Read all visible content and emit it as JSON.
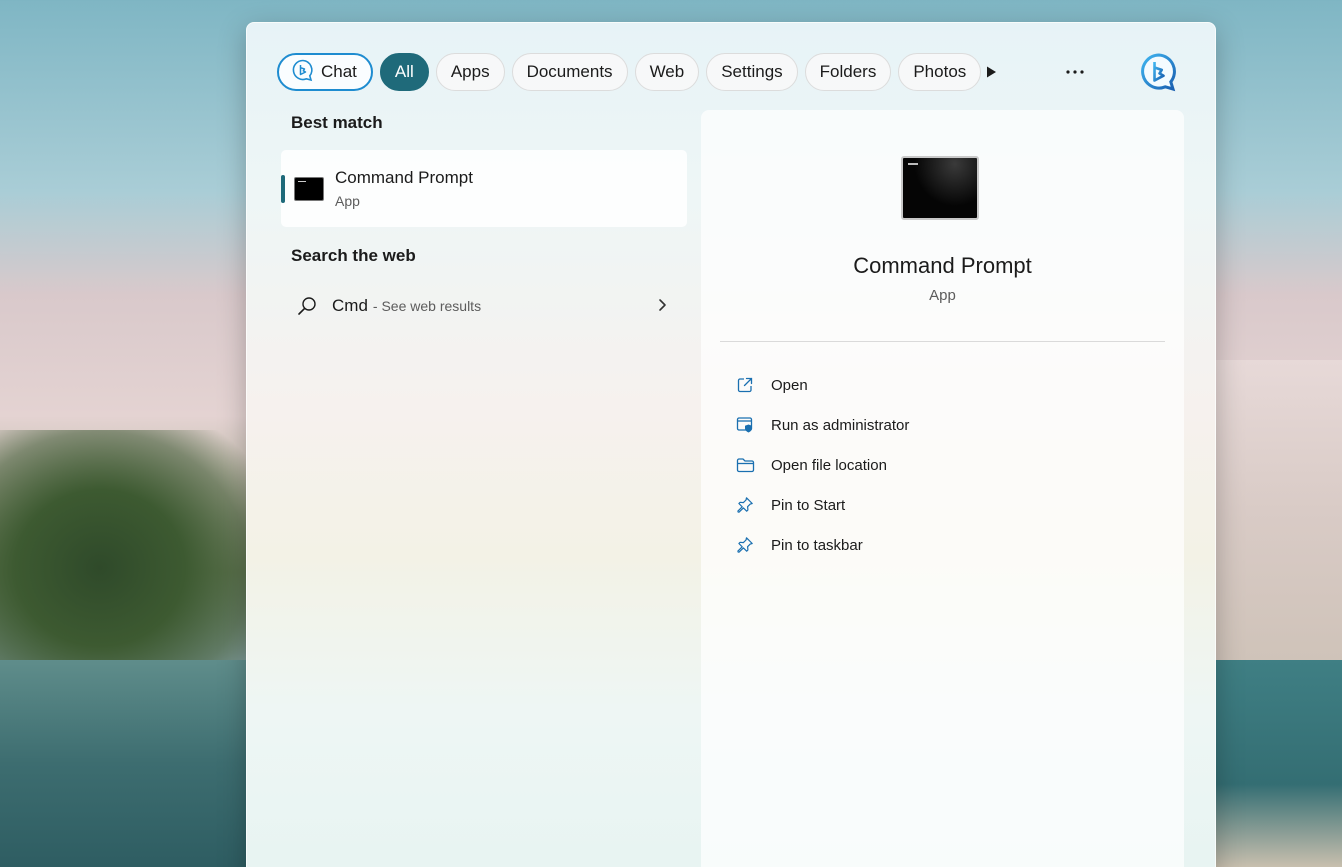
{
  "filters": {
    "chat_label": "Chat",
    "tabs": [
      {
        "label": "All",
        "active": true
      },
      {
        "label": "Apps",
        "active": false
      },
      {
        "label": "Documents",
        "active": false
      },
      {
        "label": "Web",
        "active": false
      },
      {
        "label": "Settings",
        "active": false
      },
      {
        "label": "Folders",
        "active": false
      },
      {
        "label": "Photos",
        "active": false
      }
    ],
    "icons": [
      "play-icon",
      "more-icon",
      "bing-icon"
    ]
  },
  "best_match": {
    "title": "Best match",
    "app_name": "Command Prompt",
    "app_type": "App"
  },
  "search_web": {
    "title": "Search the web",
    "query": "Cmd",
    "suffix": "- See web results"
  },
  "details": {
    "app_name": "Command Prompt",
    "app_type": "App",
    "actions": [
      {
        "label": "Open",
        "icon": "open-external-icon"
      },
      {
        "label": "Run as administrator",
        "icon": "shield-admin-icon"
      },
      {
        "label": "Open file location",
        "icon": "folder-icon"
      },
      {
        "label": "Pin to Start",
        "icon": "pin-icon"
      },
      {
        "label": "Pin to taskbar",
        "icon": "pin-icon"
      }
    ]
  },
  "colors": {
    "accent": "#1f6a7a",
    "chat_border": "#1e8cd0",
    "icon_blue": "#1a6fb0"
  }
}
